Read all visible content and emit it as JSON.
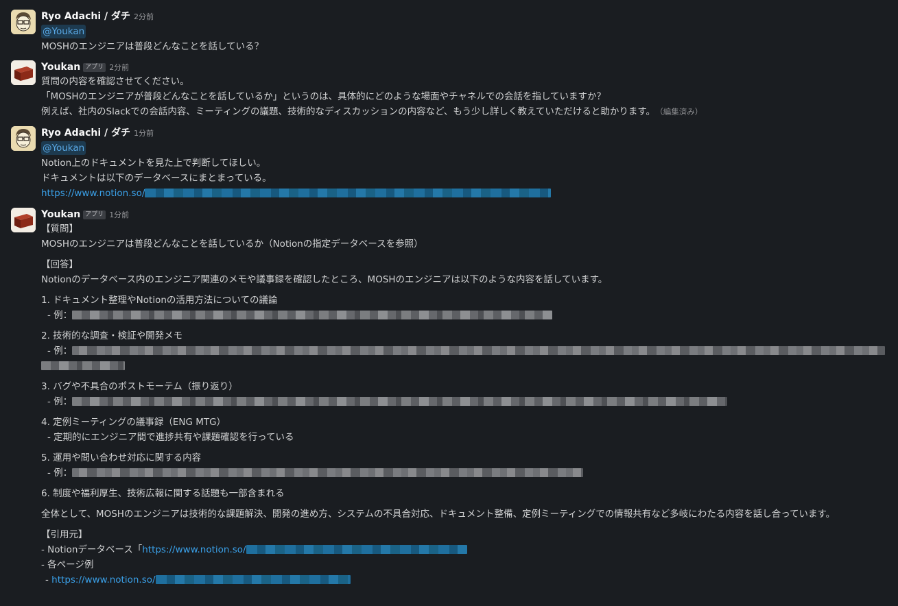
{
  "messages": [
    {
      "author": "Ryo Adachi / ダチ",
      "time": "2分前",
      "mention": "@Youkan",
      "text": "MOSHのエンジニアは普段どんなことを話している？"
    },
    {
      "author": "Youkan",
      "badge": "アプリ",
      "time": "2分前",
      "lines": [
        "質問の内容を確認させてください。",
        "「MOSHのエンジニアが普段どんなことを話しているか」というのは、具体的にどのような場面やチャネルでの会話を指していますか？",
        "例えば、社内のSlackでの会話内容、ミーティングの議題、技術的なディスカッションの内容など、もう少し詳しく教えていただけると助かります。"
      ],
      "edited": "（編集済み）"
    },
    {
      "author": "Ryo Adachi / ダチ",
      "time": "1分前",
      "mention": "@Youkan",
      "lines": [
        "Notion上のドキュメントを見た上で判断してほしい。",
        "ドキュメントは以下のデータベースにまとまっている。"
      ],
      "link": "https://www.notion.so/"
    },
    {
      "author": "Youkan",
      "badge": "アプリ",
      "time": "1分前",
      "q_heading": "【質問】",
      "q_text": "MOSHのエンジニアは普段どんなことを話しているか（Notionの指定データベースを参照）",
      "a_heading": "【回答】",
      "a_text": "Notionのデータベース内のエンジニア関連のメモや議事録を確認したところ、MOSHのエンジニアは以下のような内容を話しています。",
      "items": [
        {
          "title": "1. ドキュメント整理やNotionの活用方法についての議論",
          "sub": "- 例："
        },
        {
          "title": "2. 技術的な調査・検証や開発メモ",
          "sub": "- 例："
        },
        {
          "title": "3. バグや不具合のポストモーテム（振り返り）",
          "sub": "- 例："
        },
        {
          "title": "4. 定例ミーティングの議事録（ENG MTG）",
          "sub": "- 定期的にエンジニア間で進捗共有や課題確認を行っている"
        },
        {
          "title": "5. 運用や問い合わせ対応に関する内容",
          "sub": "- 例："
        },
        {
          "title": "6. 制度や福利厚生、技術広報に関する話題も一部含まれる"
        }
      ],
      "summary": "全体として、MOSHのエンジニアは技術的な課題解決、開発の進め方、システムの不具合対応、ドキュメント整備、定例ミーティングでの情報共有など多岐にわたる内容を話し合っています。",
      "source_heading": "【引用元】",
      "source_db_prefix": "- Notionデータベース「",
      "source_db_link": "https://www.notion.so/",
      "source_pages_label": "- 各ページ例",
      "source_page_prefix": "- ",
      "source_page_link": "https://www.notion.so/"
    }
  ]
}
